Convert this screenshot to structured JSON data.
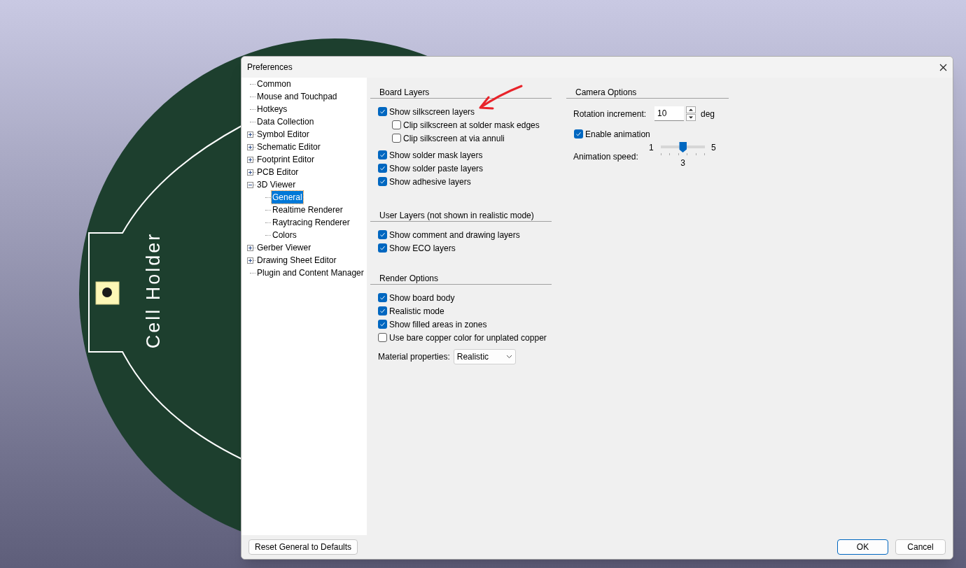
{
  "board_text": "Cell Holder",
  "window": {
    "title": "Preferences"
  },
  "tree": [
    {
      "label": "Common",
      "selected": false
    },
    {
      "label": "Mouse and Touchpad",
      "selected": false
    },
    {
      "label": "Hotkeys",
      "selected": false
    },
    {
      "label": "Data Collection",
      "selected": false
    },
    {
      "label": "Symbol Editor",
      "selected": false,
      "expanded": false
    },
    {
      "label": "Schematic Editor",
      "selected": false,
      "expanded": false
    },
    {
      "label": "Footprint Editor",
      "selected": false,
      "expanded": false
    },
    {
      "label": "PCB Editor",
      "selected": false,
      "expanded": false
    },
    {
      "label": "3D Viewer",
      "selected": false,
      "expanded": true,
      "children": [
        {
          "label": "General",
          "selected": true
        },
        {
          "label": "Realtime Renderer",
          "selected": false
        },
        {
          "label": "Raytracing Renderer",
          "selected": false
        },
        {
          "label": "Colors",
          "selected": false
        }
      ]
    },
    {
      "label": "Gerber Viewer",
      "selected": false,
      "expanded": false
    },
    {
      "label": "Drawing Sheet Editor",
      "selected": false,
      "expanded": false
    },
    {
      "label": "Plugin and Content Manager",
      "selected": false
    }
  ],
  "sections": [
    {
      "title": "Board Layers",
      "items": [
        {
          "label": "Show silkscreen layers",
          "checked": true,
          "children": [
            {
              "label": "Clip silkscreen at solder mask edges",
              "checked": false
            },
            {
              "label": "Clip silkscreen at via annuli",
              "checked": false
            }
          ]
        },
        {
          "label": "Show solder mask layers",
          "checked": true
        },
        {
          "label": "Show solder paste layers",
          "checked": true
        },
        {
          "label": "Show adhesive layers",
          "checked": true
        }
      ]
    },
    {
      "title": "User Layers (not shown in realistic mode)",
      "items": [
        {
          "label": "Show comment and drawing layers",
          "checked": true
        },
        {
          "label": "Show ECO layers",
          "checked": true
        }
      ]
    },
    {
      "title": "Render Options",
      "items": [
        {
          "label": "Show board body",
          "checked": true
        },
        {
          "label": "Realistic mode",
          "checked": true
        },
        {
          "label": "Show filled areas in zones",
          "checked": true
        },
        {
          "label": "Use bare copper color for unplated copper",
          "checked": false
        }
      ],
      "material": {
        "label": "Material properties:",
        "value": "Realistic"
      }
    }
  ],
  "camera": {
    "title": "Camera Options",
    "rotation": {
      "label": "Rotation increment:",
      "value": "10",
      "unit": "deg"
    },
    "animation": {
      "label": "Enable animation",
      "checked": true
    },
    "speed": {
      "label": "Animation speed:",
      "min": "1",
      "max": "5",
      "value": "3",
      "level": 0.5
    }
  },
  "buttons": {
    "reset": "Reset General to Defaults",
    "ok": "OK",
    "cancel": "Cancel"
  }
}
